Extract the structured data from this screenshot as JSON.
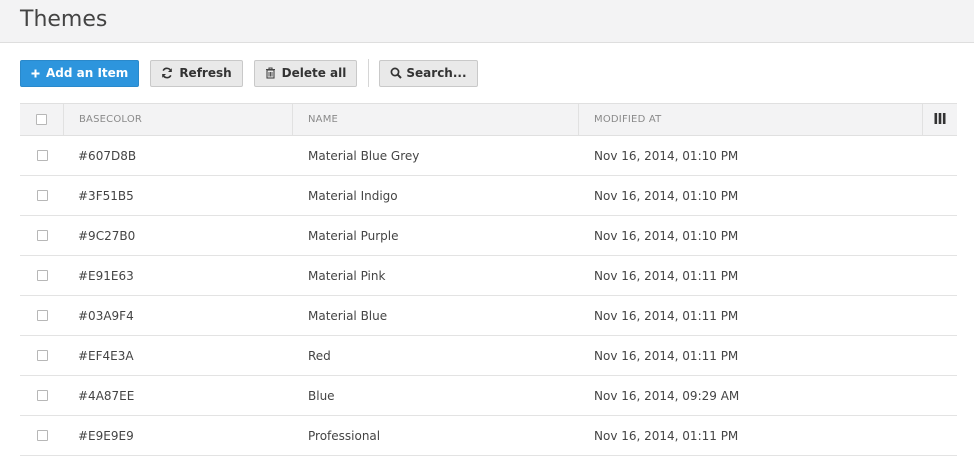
{
  "page": {
    "title": "Themes"
  },
  "toolbar": {
    "add_label": "Add an Item",
    "refresh_label": "Refresh",
    "delete_all_label": "Delete all",
    "search_label": "Search..."
  },
  "table": {
    "columns": [
      "BASECOLOR",
      "NAME",
      "MODIFIED AT"
    ],
    "rows": [
      {
        "basecolor": "#607D8B",
        "name": "Material Blue Grey",
        "modified": "Nov 16, 2014, 01:10 PM"
      },
      {
        "basecolor": "#3F51B5",
        "name": "Material Indigo",
        "modified": "Nov 16, 2014, 01:10 PM"
      },
      {
        "basecolor": "#9C27B0",
        "name": "Material Purple",
        "modified": "Nov 16, 2014, 01:10 PM"
      },
      {
        "basecolor": "#E91E63",
        "name": "Material Pink",
        "modified": "Nov 16, 2014, 01:11 PM"
      },
      {
        "basecolor": "#03A9F4",
        "name": "Material Blue",
        "modified": "Nov 16, 2014, 01:11 PM"
      },
      {
        "basecolor": "#EF4E3A",
        "name": "Red",
        "modified": "Nov 16, 2014, 01:11 PM"
      },
      {
        "basecolor": "#4A87EE",
        "name": "Blue",
        "modified": "Nov 16, 2014, 09:29 AM"
      },
      {
        "basecolor": "#E9E9E9",
        "name": "Professional",
        "modified": "Nov 16, 2014, 01:11 PM"
      }
    ]
  },
  "icons": {
    "add": "plus-icon",
    "refresh": "refresh-icon",
    "delete": "trash-icon",
    "search": "search-icon",
    "columns": "columns-icon"
  },
  "colors": {
    "primary": "#2D95DD",
    "header_bg": "#F3F3F4"
  }
}
